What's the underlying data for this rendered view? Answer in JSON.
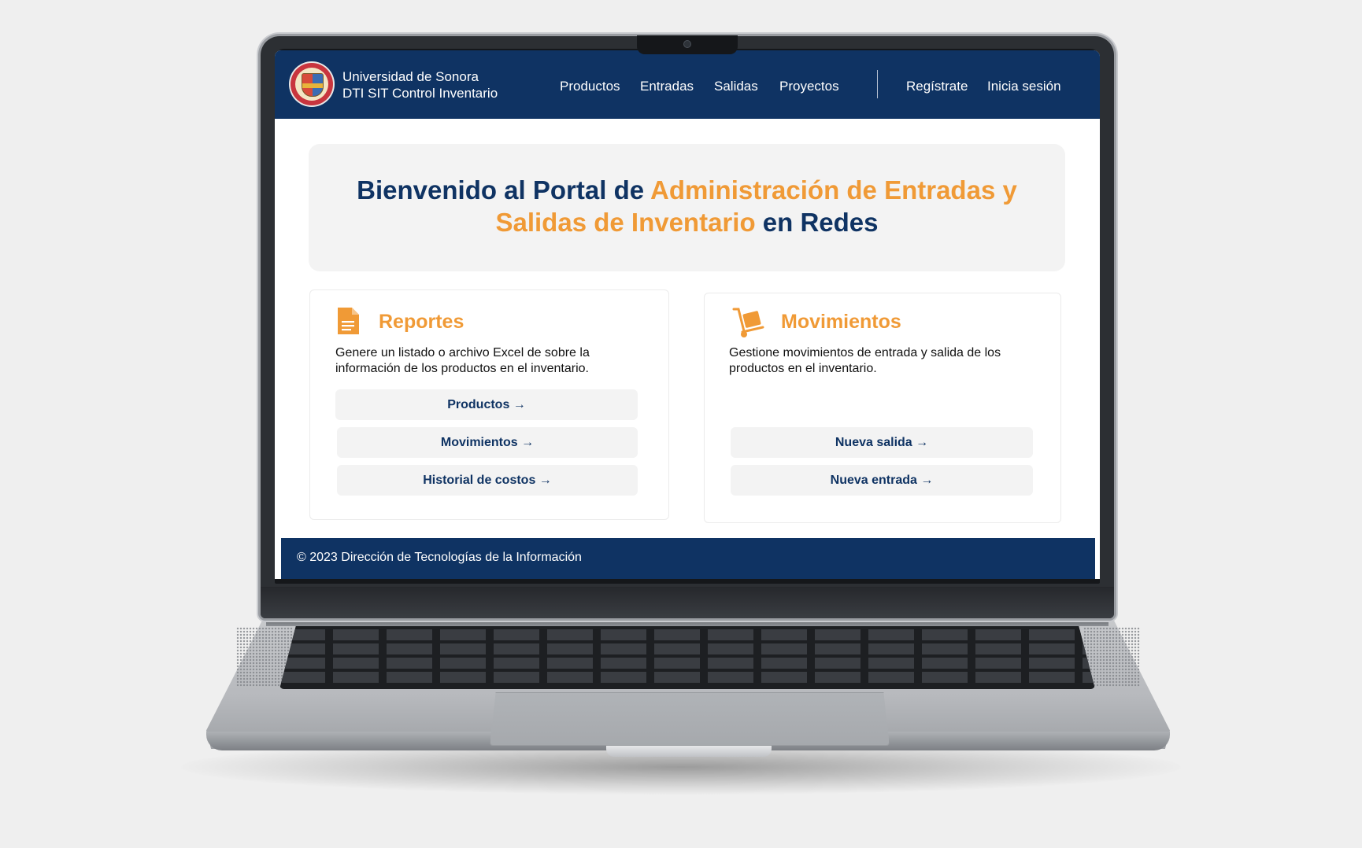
{
  "brand": {
    "line1": "Universidad de Sonora",
    "line2": "DTI SIT Control Inventario"
  },
  "nav": {
    "items": [
      {
        "label": "Productos"
      },
      {
        "label": "Entradas"
      },
      {
        "label": "Salidas"
      },
      {
        "label": "Proyectos"
      }
    ],
    "register": "Regístrate",
    "login": "Inicia sesión"
  },
  "hero": {
    "part1": "Bienvenido al Portal de ",
    "accent": "Administración de Entradas y Salidas de Inventario",
    "part2": " en Redes"
  },
  "reportes": {
    "title": "Reportes",
    "icon": "document-icon",
    "description": "Genere un listado o archivo Excel de sobre la información de los productos en el inventario.",
    "buttons": [
      {
        "label": "Productos →"
      },
      {
        "label": "Movimientos →"
      },
      {
        "label": "Historial de costos →"
      }
    ]
  },
  "movimientos": {
    "title": "Movimientos",
    "icon": "dolly-icon",
    "description": "Gestione movimientos de entrada y salida de los productos en el inventario.",
    "buttons": [
      {
        "label": "Nueva salida →"
      },
      {
        "label": "Nueva entrada →"
      }
    ]
  },
  "footer": {
    "text": "© 2023 Dirección de Tecnologías de la Información"
  },
  "colors": {
    "navy": "#0f3363",
    "orange": "#f09a36",
    "panel": "#f3f3f3"
  }
}
